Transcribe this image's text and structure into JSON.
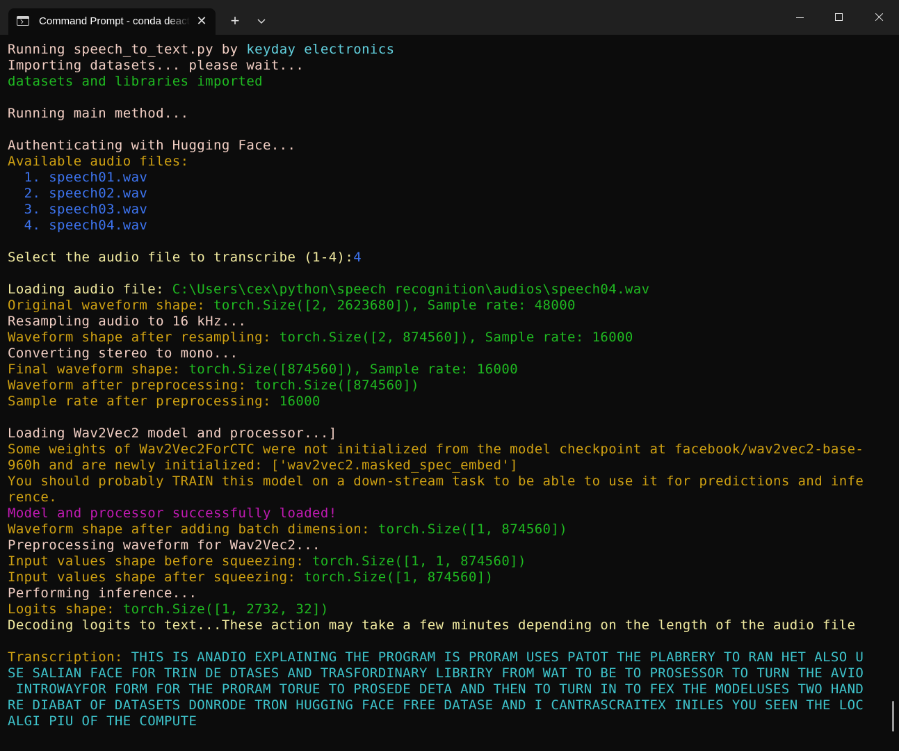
{
  "window": {
    "tab_title": "Command Prompt - conda deactivate",
    "tab_icon": "terminal-icon",
    "new_tab_label": "+",
    "close_tab_label": "✕"
  },
  "colors": {
    "background": "#0c0c0c",
    "titlebar": "#202020",
    "pink": "#f2cfc4",
    "cyan": "#62d1df",
    "green": "#1fba21",
    "gold": "#cfa112",
    "blue": "#3d74f0",
    "magenta": "#c21ab4",
    "yellow": "#f2eba0",
    "teal": "#3ec4cc"
  },
  "terminal": {
    "lines": [
      [
        {
          "t": "Running speech_to_text.py by ",
          "c": "pink"
        },
        {
          "t": "keyday electronics",
          "c": "cyan"
        }
      ],
      [
        {
          "t": "Importing datasets... please wait...",
          "c": "pink"
        }
      ],
      [
        {
          "t": "datasets and libraries imported",
          "c": "green"
        }
      ],
      [],
      [
        {
          "t": "Running main method...",
          "c": "pink"
        }
      ],
      [],
      [
        {
          "t": "Authenticating with Hugging Face...",
          "c": "pink"
        }
      ],
      [
        {
          "t": "Available audio files:",
          "c": "gold"
        }
      ],
      [
        {
          "t": "  1. speech01.wav",
          "c": "blue"
        }
      ],
      [
        {
          "t": "  2. speech02.wav",
          "c": "blue"
        }
      ],
      [
        {
          "t": "  3. speech03.wav",
          "c": "blue"
        }
      ],
      [
        {
          "t": "  4. speech04.wav",
          "c": "blue"
        }
      ],
      [],
      [
        {
          "t": "Select the audio file to transcribe (1-4):",
          "c": "yellow"
        },
        {
          "t": "4",
          "c": "blue"
        }
      ],
      [],
      [
        {
          "t": "Loading audio file: ",
          "c": "yellow"
        },
        {
          "t": "C:\\Users\\cex\\python\\speech recognition\\audios\\speech04.wav",
          "c": "green"
        }
      ],
      [
        {
          "t": "Original waveform shape: ",
          "c": "gold"
        },
        {
          "t": "torch.Size([2, 2623680]), Sample rate: 48000",
          "c": "green"
        }
      ],
      [
        {
          "t": "Resampling audio to 16 kHz...",
          "c": "pink"
        }
      ],
      [
        {
          "t": "Waveform shape after resampling: ",
          "c": "gold"
        },
        {
          "t": "torch.Size([2, 874560]), Sample rate: 16000",
          "c": "green"
        }
      ],
      [
        {
          "t": "Converting stereo to mono...",
          "c": "pink"
        }
      ],
      [
        {
          "t": "Final waveform shape: ",
          "c": "gold"
        },
        {
          "t": "torch.Size([874560]), Sample rate: 16000",
          "c": "green"
        }
      ],
      [
        {
          "t": "Waveform after preprocessing: ",
          "c": "gold"
        },
        {
          "t": "torch.Size([874560])",
          "c": "green"
        }
      ],
      [
        {
          "t": "Sample rate after preprocessing: ",
          "c": "gold"
        },
        {
          "t": "16000",
          "c": "green"
        }
      ],
      [],
      [
        {
          "t": "Loading Wav2Vec2 model and processor...]",
          "c": "pink"
        }
      ],
      [
        {
          "t": "Some weights of Wav2Vec2ForCTC were not initialized from the model checkpoint at facebook/wav2vec2-base-",
          "c": "gold"
        }
      ],
      [
        {
          "t": "960h and are newly initialized: ['wav2vec2.masked_spec_embed']",
          "c": "gold"
        }
      ],
      [
        {
          "t": "You should probably TRAIN this model on a down-stream task to be able to use it for predictions and infe",
          "c": "gold"
        }
      ],
      [
        {
          "t": "rence.",
          "c": "gold"
        }
      ],
      [
        {
          "t": "Model and processor successfully loaded!",
          "c": "magenta"
        }
      ],
      [
        {
          "t": "Waveform shape after adding batch dimension: ",
          "c": "gold"
        },
        {
          "t": "torch.Size([1, 874560])",
          "c": "green"
        }
      ],
      [
        {
          "t": "Preprocessing waveform for Wav2Vec2...",
          "c": "pink"
        }
      ],
      [
        {
          "t": "Input values shape before squeezing: ",
          "c": "gold"
        },
        {
          "t": "torch.Size([1, 1, 874560])",
          "c": "green"
        }
      ],
      [
        {
          "t": "Input values shape after squeezing: ",
          "c": "gold"
        },
        {
          "t": "torch.Size([1, 874560])",
          "c": "green"
        }
      ],
      [
        {
          "t": "Performing inference...",
          "c": "pink"
        }
      ],
      [
        {
          "t": "Logits shape: ",
          "c": "gold"
        },
        {
          "t": "torch.Size([1, 2732, 32])",
          "c": "green"
        }
      ],
      [
        {
          "t": "Decoding logits to text...These action may take a few minutes depending on the length of the audio file",
          "c": "yellow"
        }
      ],
      [],
      [
        {
          "t": "Transcription: ",
          "c": "gold"
        },
        {
          "t": "THIS IS ANADIO EXPLAINING THE PROGRAM IS PRORAM USES PATOT THE PLABRERY TO RAN HET ALSO U",
          "c": "teal"
        }
      ],
      [
        {
          "t": "SE SALIAN FACE FOR TRIN DE DTASES AND TRASFORDINARY LIBRIRY FROM WAT TO BE TO PROSESSOR TO TURN THE AVIO",
          "c": "teal"
        }
      ],
      [
        {
          "t": " INTROWAYFOR FORM FOR THE PRORAM TORUE TO PROSEDE DETA AND THEN TO TURN IN TO FEX THE MODELUSES TWO HAND",
          "c": "teal"
        }
      ],
      [
        {
          "t": "RE DIABAT OF DATASETS DONRODE TRON HUGGING FACE FREE DATASE AND I CANTRASCRAITEX INILES YOU SEEN THE LOC",
          "c": "teal"
        }
      ],
      [
        {
          "t": "ALGI PIU OF THE COMPUTE",
          "c": "teal"
        }
      ]
    ]
  }
}
